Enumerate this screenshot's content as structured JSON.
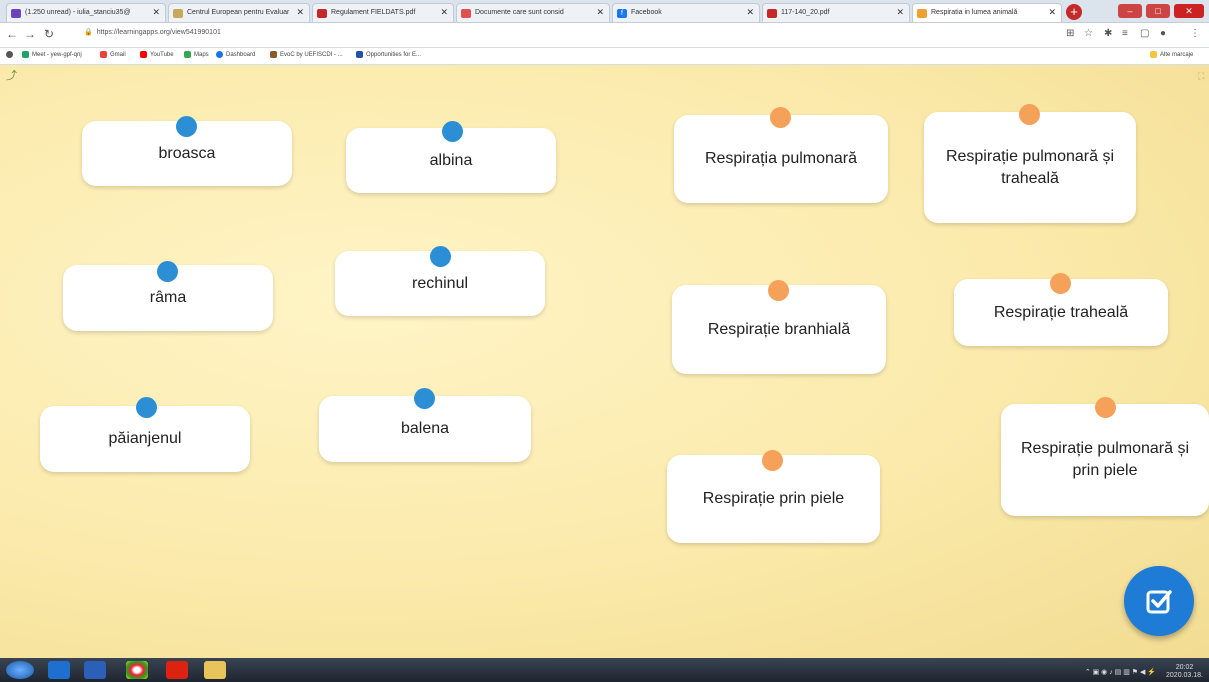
{
  "browser": {
    "tabs": [
      {
        "label": "(1.250 unread) - iulia_stanciu35@",
        "icon_color": "#6b44b8",
        "active": false
      },
      {
        "label": "Centrul European pentru Evaluar",
        "icon_color": "#c8a85a",
        "active": false
      },
      {
        "label": "Regulament FIELDATS.pdf",
        "icon_color": "#c62828",
        "active": false
      },
      {
        "label": "Documente care sunt consid",
        "icon_color": "#e05050",
        "active": false
      },
      {
        "label": "Facebook",
        "icon_color": "#1877f2",
        "active": false
      },
      {
        "label": "117-140_20.pdf",
        "icon_color": "#c62828",
        "active": false
      },
      {
        "label": "Respiratia in lumea animală",
        "icon_color": "#f0a030",
        "active": true
      }
    ],
    "url": "https://learningapps.org/view541990101",
    "bookmarks": [
      {
        "label": "Meet - yew-gpf-qnj",
        "color": "#1ea362"
      },
      {
        "label": "Gmail",
        "color": "#ea4335"
      },
      {
        "label": "YouTube",
        "color": "#ff0000"
      },
      {
        "label": "Maps",
        "color": "#34a853"
      },
      {
        "label": "Dashboard",
        "color": "#1a73e8"
      },
      {
        "label": "EvoC by UEFISCDI - ...",
        "color": "#8a5a2b"
      },
      {
        "label": "Opportunities for E...",
        "color": "#2450a8"
      }
    ],
    "other_bookmarks": "Alte marcaje"
  },
  "activity": {
    "animals": [
      {
        "label": "broasca"
      },
      {
        "label": "albina"
      },
      {
        "label": "râma"
      },
      {
        "label": "rechinul"
      },
      {
        "label": "păianjenul"
      },
      {
        "label": "balena"
      }
    ],
    "respiration_types": [
      {
        "label": "Respirația pulmonară"
      },
      {
        "label": "Respirație pulmonară și traheală"
      },
      {
        "label": "Respirație branhială"
      },
      {
        "label": "Respirație traheală"
      },
      {
        "label": "Respirație prin piele"
      },
      {
        "label": "Respirație pulmonară și prin piele"
      }
    ],
    "dot_colors": {
      "animals": "#2c8fd6",
      "respiration": "#f5a15a"
    },
    "check_button_color": "#1e7bd6"
  },
  "taskbar": {
    "time": "20:02",
    "date": "2020.03.18."
  }
}
